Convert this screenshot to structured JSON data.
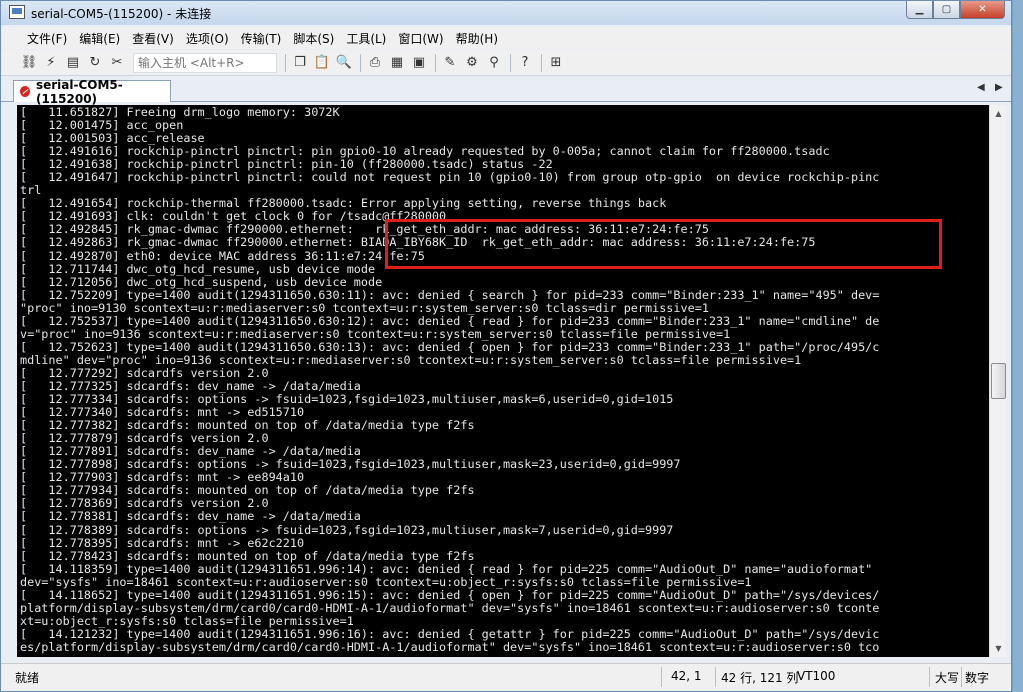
{
  "window": {
    "title": "serial-COM5-(115200) - 未连接"
  },
  "menu": [
    "文件(F)",
    "编辑(E)",
    "查看(V)",
    "选项(O)",
    "传输(T)",
    "脚本(S)",
    "工具(L)",
    "窗口(W)",
    "帮助(H)"
  ],
  "toolbar": {
    "host_placeholder": "输入主机 <Alt+R>"
  },
  "tab": {
    "label": "serial-COM5-(115200)"
  },
  "terminal": {
    "lines": [
      "[   11.651827] Freeing drm_logo memory: 3072K",
      "[   12.001475] acc_open",
      "[   12.001503] acc_release",
      "[   12.491616] rockchip-pinctrl pinctrl: pin gpio0-10 already requested by 0-005a; cannot claim for ff280000.tsadc",
      "[   12.491638] rockchip-pinctrl pinctrl: pin-10 (ff280000.tsadc) status -22",
      "[   12.491647] rockchip-pinctrl pinctrl: could not request pin 10 (gpio0-10) from group otp-gpio  on device rockchip-pinc",
      "trl",
      "[   12.491654] rockchip-thermal ff280000.tsadc: Error applying setting, reverse things back",
      "[   12.491693] clk: couldn't get clock 0 for /tsadc@ff280000",
      "[   12.492845] rk_gmac-dwmac ff290000.ethernet:   rk_get_eth_addr: mac address: 36:11:e7:24:fe:75",
      "[   12.492863] rk_gmac-dwmac ff290000.ethernet: BIADA_IBY68K_ID  rk_get_eth_addr: mac address: 36:11:e7:24:fe:75",
      "[   12.492870] eth0: device MAC address 36:11:e7:24:fe:75",
      "[   12.711744] dwc_otg_hcd_resume, usb device mode",
      "[   12.712056] dwc_otg_hcd_suspend, usb device mode",
      "[   12.752209] type=1400 audit(1294311650.630:11): avc: denied { search } for pid=233 comm=\"Binder:233_1\" name=\"495\" dev=",
      "\"proc\" ino=9130 scontext=u:r:mediaserver:s0 tcontext=u:r:system_server:s0 tclass=dir permissive=1",
      "[   12.752537] type=1400 audit(1294311650.630:12): avc: denied { read } for pid=233 comm=\"Binder:233_1\" name=\"cmdline\" de",
      "v=\"proc\" ino=9136 scontext=u:r:mediaserver:s0 tcontext=u:r:system_server:s0 tclass=file permissive=1",
      "[   12.752623] type=1400 audit(1294311650.630:13): avc: denied { open } for pid=233 comm=\"Binder:233_1\" path=\"/proc/495/c",
      "mdline\" dev=\"proc\" ino=9136 scontext=u:r:mediaserver:s0 tcontext=u:r:system_server:s0 tclass=file permissive=1",
      "[   12.777292] sdcardfs version 2.0",
      "[   12.777325] sdcardfs: dev_name -> /data/media",
      "[   12.777334] sdcardfs: options -> fsuid=1023,fsgid=1023,multiuser,mask=6,userid=0,gid=1015",
      "[   12.777340] sdcardfs: mnt -> ed515710",
      "[   12.777382] sdcardfs: mounted on top of /data/media type f2fs",
      "[   12.777879] sdcardfs version 2.0",
      "[   12.777891] sdcardfs: dev_name -> /data/media",
      "[   12.777898] sdcardfs: options -> fsuid=1023,fsgid=1023,multiuser,mask=23,userid=0,gid=9997",
      "[   12.777903] sdcardfs: mnt -> ee894a10",
      "[   12.777934] sdcardfs: mounted on top of /data/media type f2fs",
      "[   12.778369] sdcardfs version 2.0",
      "[   12.778381] sdcardfs: dev_name -> /data/media",
      "[   12.778389] sdcardfs: options -> fsuid=1023,fsgid=1023,multiuser,mask=7,userid=0,gid=9997",
      "[   12.778395] sdcardfs: mnt -> e62c2210",
      "[   12.778423] sdcardfs: mounted on top of /data/media type f2fs",
      "[   14.118359] type=1400 audit(1294311651.996:14): avc: denied { read } for pid=225 comm=\"AudioOut_D\" name=\"audioformat\"",
      "dev=\"sysfs\" ino=18461 scontext=u:r:audioserver:s0 tcontext=u:object_r:sysfs:s0 tclass=file permissive=1",
      "[   14.118652] type=1400 audit(1294311651.996:15): avc: denied { open } for pid=225 comm=\"AudioOut_D\" path=\"/sys/devices/",
      "platform/display-subsystem/drm/card0/card0-HDMI-A-1/audioformat\" dev=\"sysfs\" ino=18461 scontext=u:r:audioserver:s0 tconte",
      "xt=u:object_r:sysfs:s0 tclass=file permissive=1",
      "[   14.121232] type=1400 audit(1294311651.996:16): avc: denied { getattr } for pid=225 comm=\"AudioOut_D\" path=\"/sys/devic",
      "es/platform/display-subsystem/drm/card0/card0-HDMI-A-1/audioformat\" dev=\"sysfs\" ino=18461 scontext=u:r:audioserver:s0 tco"
    ]
  },
  "status": {
    "ready": "就绪",
    "cursor": "42,  1",
    "size": "42 行, 121 列",
    "emulation": "VT100",
    "caps": "大写",
    "num": "数字"
  },
  "colors": {
    "highlight_box": "#e01d1d",
    "terminal_bg": "#000000",
    "terminal_fg": "#e6e6e6"
  }
}
